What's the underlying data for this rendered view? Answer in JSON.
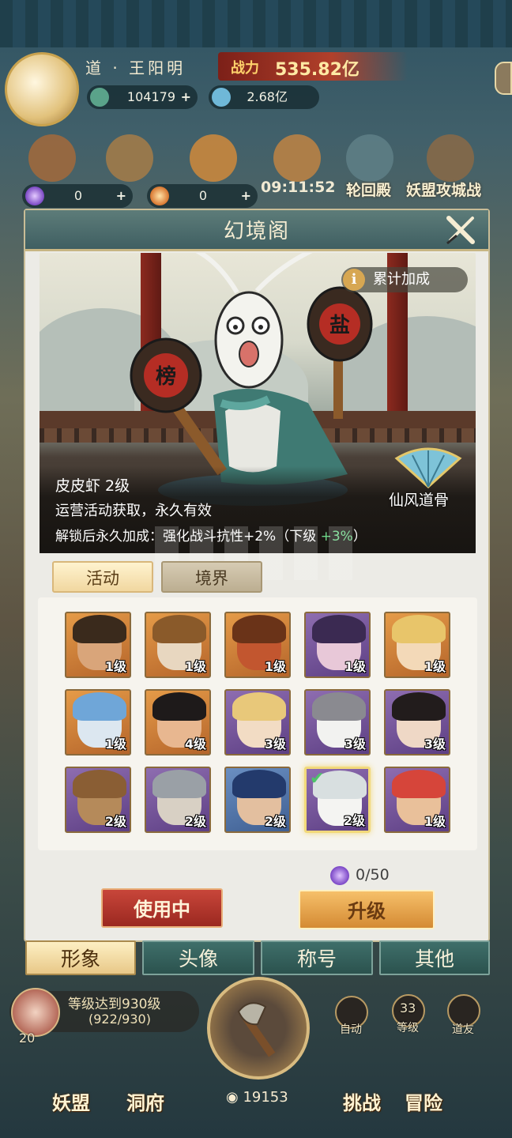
{
  "hud": {
    "player_name": "道 · 王阳明",
    "power_label": "战力",
    "power_value": "535.82亿",
    "currency_1": "104179",
    "currency_2": "2.68亿",
    "res_purple": "0",
    "res_orange": "0",
    "timer": "09:11:52",
    "event_1": "轮回殿",
    "event_2": "妖盟攻城战",
    "plus": "+"
  },
  "modal": {
    "title": "幻境阁",
    "info_chip": "累计加成",
    "info_icon": "i",
    "skin_name": "皮皮虾 2级",
    "skin_source": "运营活动获取，永久有效",
    "bonus_prefix": "解锁后永久加成：强化战斗抗性+2%（下级 ",
    "bonus_next": "+3%",
    "bonus_suffix": "）",
    "badge_label": "仙风道骨",
    "lantern_left": "榜",
    "lantern_right": "盐",
    "tabs": [
      {
        "label": "活动",
        "active": true
      },
      {
        "label": "境界",
        "active": false
      }
    ],
    "grid": [
      {
        "level": "1级",
        "color": "orange",
        "skin": "#d9a57a",
        "hair": "#3a2a1c"
      },
      {
        "level": "1级",
        "color": "orange",
        "skin": "#e8d7c0",
        "hair": "#8a5a2a"
      },
      {
        "level": "1级",
        "color": "orange",
        "skin": "#c2562f",
        "hair": "#6a3318"
      },
      {
        "level": "1级",
        "color": "purple",
        "skin": "#e8c8d8",
        "hair": "#3b2a52"
      },
      {
        "level": "1级",
        "color": "orange",
        "skin": "#f3d9b8",
        "hair": "#e8c56a"
      },
      {
        "level": "1级",
        "color": "orange",
        "skin": "#dce7f0",
        "hair": "#6fa6d8"
      },
      {
        "level": "4级",
        "color": "orange",
        "skin": "#e8b790",
        "hair": "#1e1a1a"
      },
      {
        "level": "3级",
        "color": "purple",
        "skin": "#f2dcc4",
        "hair": "#e8c87a"
      },
      {
        "level": "3级",
        "color": "purple",
        "skin": "#f2f2f0",
        "hair": "#8a8a90"
      },
      {
        "level": "3级",
        "color": "purple",
        "skin": "#efd8c6",
        "hair": "#221c1c"
      },
      {
        "level": "2级",
        "color": "purple",
        "skin": "#b58a5a",
        "hair": "#8a5e34"
      },
      {
        "level": "2级",
        "color": "purple",
        "skin": "#d8d0c4",
        "hair": "#9aa0a6"
      },
      {
        "level": "2级",
        "color": "blue",
        "skin": "#e3bf9f",
        "hair": "#233a6c"
      },
      {
        "level": "2级",
        "color": "purple",
        "skin": "#f4f4f2",
        "hair": "#d8dfe0",
        "selected": true
      },
      {
        "level": "1级",
        "color": "purple",
        "skin": "#e9c09a",
        "hair": "#d6453a"
      }
    ],
    "cost": "0/50",
    "btn_in_use": "使用中",
    "btn_upgrade": "升级",
    "bottom_tabs": [
      {
        "label": "形象",
        "active": true
      },
      {
        "label": "头像",
        "active": false
      },
      {
        "label": "称号",
        "active": false
      },
      {
        "label": "其他",
        "active": false
      }
    ]
  },
  "bottom": {
    "level_text": "等级达到930级",
    "level_progress": "(922/930)",
    "level_badge": "20",
    "coin_value": "19153",
    "right_btn_1": "自动",
    "right_btn_2": "等级",
    "right_btn_2_num": "33",
    "right_btn_3": "道友",
    "nav": [
      "妖盟",
      "洞府",
      "挑战",
      "冒险"
    ]
  },
  "colors": {
    "accent_red": "#b3362b",
    "accent_gold": "#e2a249",
    "green": "#6fd98a"
  }
}
